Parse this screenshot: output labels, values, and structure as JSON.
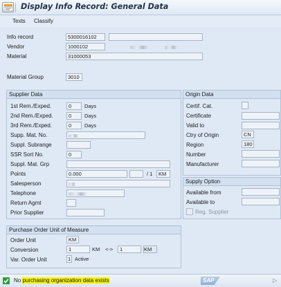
{
  "title": "Display Info Record: General Data",
  "toolbar": {
    "texts": "Texts",
    "classify": "Classify"
  },
  "header": {
    "info_record_label": "Info record",
    "info_record_value": "5300016102",
    "vendor_label": "Vendor",
    "vendor_value": "1000102",
    "material_label": "Material",
    "material_value": "31000053",
    "material_group_label": "Material Group",
    "material_group_value": "3010"
  },
  "supplier": {
    "title": "Supplier Data",
    "rem1_label": "1st Rem./Exped.",
    "rem1_value": "0",
    "rem2_label": "2nd Rem./Exped.",
    "rem2_value": "0",
    "rem3_label": "3rd Rem./Exped.",
    "rem3_value": "0",
    "days": "Days",
    "supp_mat_no_label": "Supp. Mat. No.",
    "supp_subrange_label": "Suppl. Subrange",
    "ssr_sort_label": "SSR Sort No.",
    "ssr_sort_value": "0",
    "suppl_mat_grp_label": "Suppl. Mat. Grp",
    "points_label": "Points",
    "points_value": "0.000",
    "points_per": "/ 1",
    "points_unit": "KM",
    "salesperson_label": "Salesperson",
    "telephone_label": "Telephone",
    "return_agmt_label": "Return Agmt",
    "prior_supplier_label": "Prior Supplier"
  },
  "origin": {
    "title": "Origin Data",
    "certif_cat_label": "Certif. Cat.",
    "certificate_label": "Certificate",
    "valid_to_label": "Valid to",
    "ctry_origin_label": "Ctry of Origin",
    "ctry_origin_value": "CN",
    "region_label": "Region",
    "region_value": "180",
    "number_label": "Number",
    "manufacturer_label": "Manufacturer"
  },
  "supply": {
    "title": "Supply Option",
    "available_from_label": "Available from",
    "available_to_label": "Available to",
    "reg_supplier_label": "Reg. Supplier"
  },
  "po_uom": {
    "title": "Purchase Order Unit of Measure",
    "order_unit_label": "Order Unit",
    "order_unit_value": "KM",
    "conversion_label": "Conversion",
    "conv_left_value": "1",
    "conv_left_unit": "KM",
    "conv_arrow": "<->",
    "conv_right_value": "1",
    "conv_right_unit": "KM",
    "var_order_unit_label": "Var. Order Unit",
    "var_order_unit_value": "1",
    "var_order_unit_text": "Active"
  },
  "status": {
    "prefix": "No ",
    "highlighted": "purchasing organization data exists",
    "logo": "SAP",
    "color": "#2e9a3a"
  }
}
